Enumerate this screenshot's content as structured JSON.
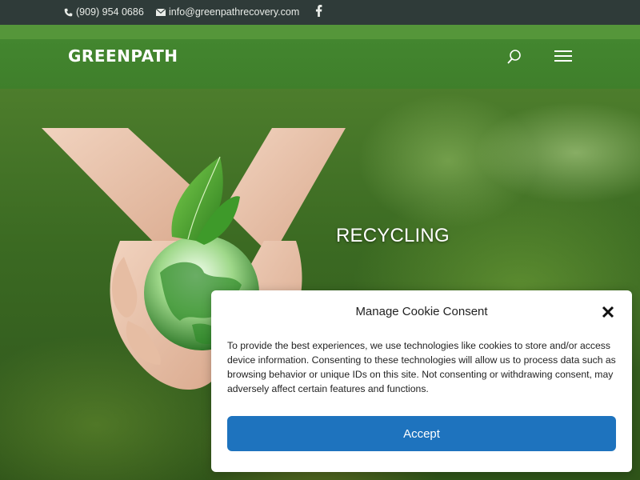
{
  "topbar": {
    "phone": "(909) 954 0686",
    "email": "info@greenpathrecovery.com",
    "social_icon": "facebook-icon"
  },
  "header": {
    "logo_text": "GREENPATH",
    "search_icon": "search-icon",
    "menu_icon": "hamburger-menu-icon"
  },
  "hero": {
    "title": "RECYCLING"
  },
  "cookie_banner": {
    "title": "Manage Cookie Consent",
    "text": "To provide the best experiences, we use technologies like cookies to store and/or access device information. Consenting to these technologies will allow us to process data such as browsing behavior or unique IDs on this site. Not consenting or withdrawing consent, may adversely affect certain features and functions.",
    "accept_label": "Accept",
    "accent_color": "#1e73be"
  },
  "colors": {
    "topbar": "#2f3b39",
    "header": "#43862f"
  }
}
